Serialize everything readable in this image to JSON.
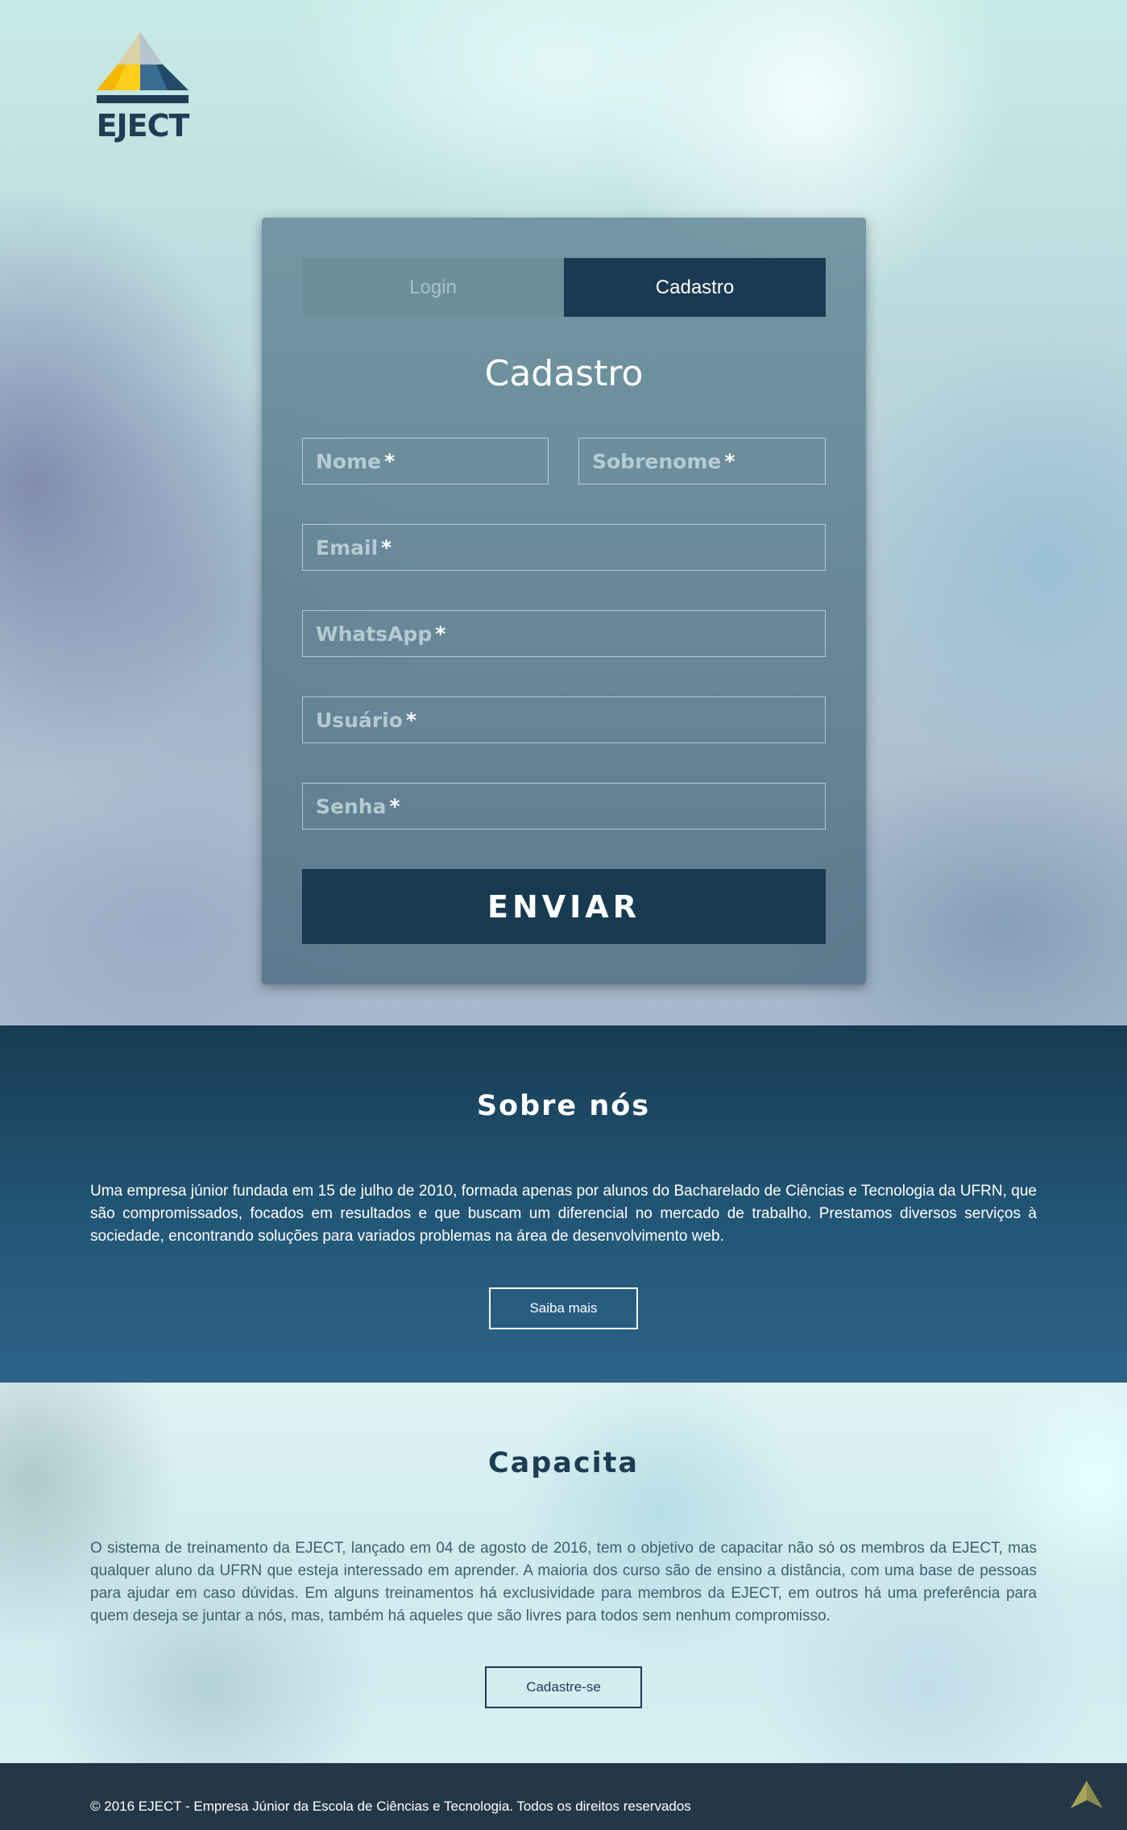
{
  "brand": {
    "logo_text": "EJECT",
    "colors": {
      "navy": "#193a52",
      "gold": "#f5b800",
      "light_blue": "#9fb8d0"
    }
  },
  "auth": {
    "tabs": [
      {
        "label": "Login",
        "active": false
      },
      {
        "label": "Cadastro",
        "active": true
      }
    ],
    "form_title": "Cadastro",
    "fields": {
      "nome": {
        "placeholder": "Nome",
        "required": "*"
      },
      "sobrenome": {
        "placeholder": "Sobrenome",
        "required": "*"
      },
      "email": {
        "placeholder": "Email",
        "required": "*"
      },
      "whatsapp": {
        "placeholder": "WhatsApp",
        "required": "*"
      },
      "usuario": {
        "placeholder": "Usuário",
        "required": "*"
      },
      "senha": {
        "placeholder": "Senha",
        "required": "*"
      }
    },
    "submit_label": "ENVIAR"
  },
  "sobre": {
    "title": "Sobre nós",
    "text": "Uma empresa júnior fundada em 15 de julho de 2010, formada apenas por alunos do Bacharelado de Ciências e Tecnologia da UFRN, que são compromissados, focados em resultados e que buscam um diferencial no mercado de trabalho. Prestamos diversos serviços à sociedade, encontrando soluções para variados problemas na área de desenvolvimento web.",
    "button_label": "Saiba mais"
  },
  "capacita": {
    "title": "Capacita",
    "text": "O sistema de treinamento da EJECT, lançado em 04 de agosto de 2016, tem o objetivo de capacitar não só os membros da EJECT, mas qualquer aluno da UFRN que esteja interessado em aprender. A maioria dos curso são de ensino a distância, com uma base de pessoas para ajudar em caso dúvidas. Em alguns treinamentos há exclusividade para membros da EJECT, em outros há uma preferência para quem deseja se juntar a nós, mas, também há aqueles que são livres para todos sem nenhum compromisso.",
    "button_label": "Cadastre-se"
  },
  "footer": {
    "text": "© 2016 EJECT - Empresa Júnior da Escola de Ciências e Tecnologia. Todos os direitos reservados",
    "back_to_top_icon": "chevron-up-icon"
  }
}
